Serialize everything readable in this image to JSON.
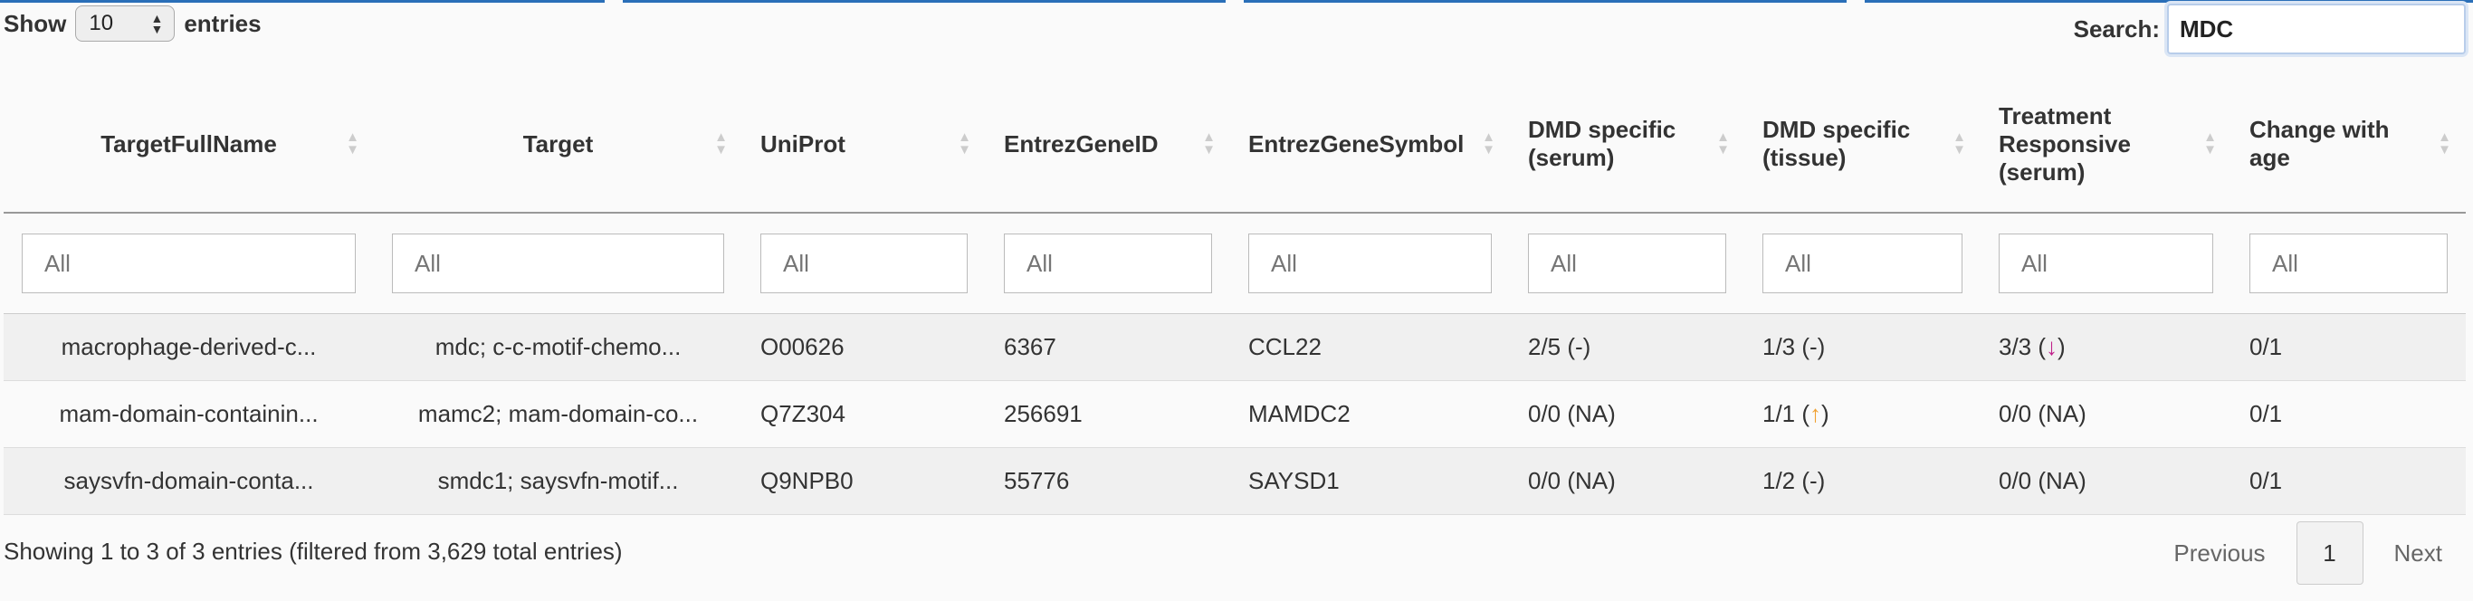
{
  "controls": {
    "show_label": "Show",
    "page_size": "10",
    "entries_label": "entries",
    "search_label": "Search:",
    "search_value": "MDC"
  },
  "columns": [
    "TargetFullName",
    "Target",
    "UniProt",
    "EntrezGeneID",
    "EntrezGeneSymbol",
    "DMD specific (serum)",
    "DMD specific (tissue)",
    "Treatment Responsive (serum)",
    "Change with age"
  ],
  "filter_placeholder": "All",
  "rows": [
    {
      "full_name": "macrophage-derived-c...",
      "target": "mdc; c-c-motif-chemo...",
      "uniprot": "O00626",
      "entrez_id": "6367",
      "symbol": "CCL22",
      "dmd_serum": "2/5 (-)",
      "dmd_tissue": "1/3 (-)",
      "treat_value": "3/3 (",
      "treat_icon": "↓",
      "treat_close": ")",
      "age": "0/1"
    },
    {
      "full_name": "mam-domain-containin...",
      "target": "mamc2; mam-domain-co...",
      "uniprot": "Q7Z304",
      "entrez_id": "256691",
      "symbol": "MAMDC2",
      "dmd_serum": "0/0 (NA)",
      "tissue_value": "1/1 (",
      "tissue_icon": "↑",
      "tissue_close": ")",
      "treat_text": "0/0 (NA)",
      "age": "0/1"
    },
    {
      "full_name": "saysvfn-domain-conta...",
      "target": "smdc1; saysvfn-motif...",
      "uniprot": "Q9NPB0",
      "entrez_id": "55776",
      "symbol": "SAYSD1",
      "dmd_serum": "0/0 (NA)",
      "dmd_tissue": "1/2 (-)",
      "treat_text": "0/0 (NA)",
      "age": "0/1"
    }
  ],
  "footer": {
    "info": "Showing 1 to 3 of 3 entries (filtered from 3,629 total entries)",
    "previous": "Previous",
    "page": "1",
    "next": "Next"
  },
  "colors": {
    "accent": "#2a6fb8",
    "up_arrow": "#f0a030",
    "down_arrow": "#c0208a"
  }
}
